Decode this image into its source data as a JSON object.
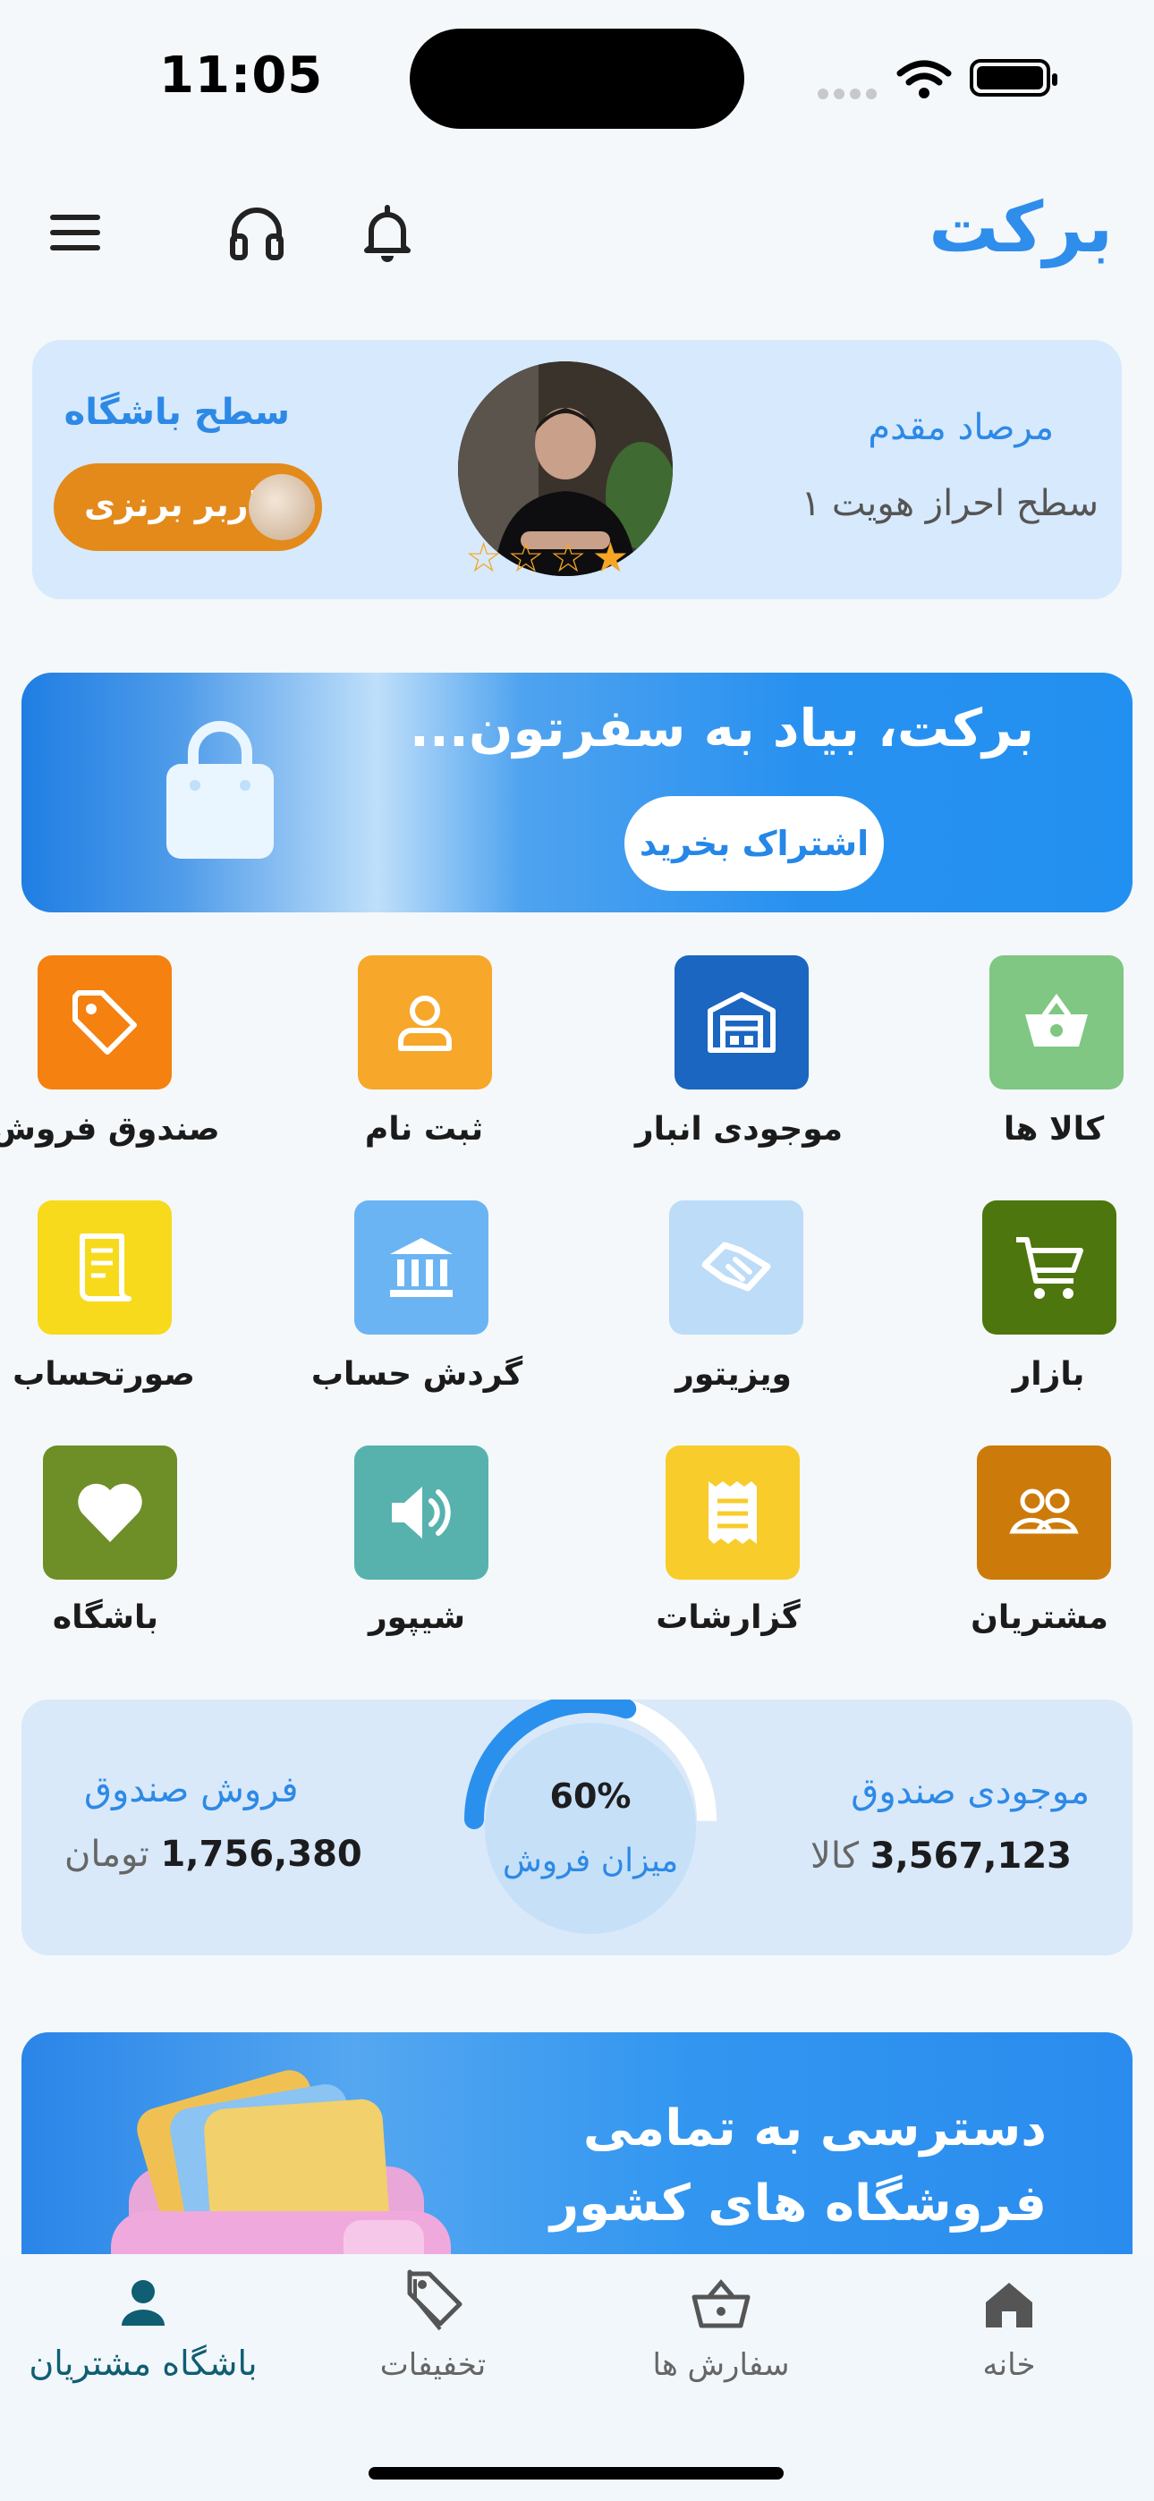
{
  "status_bar": {
    "time": "11:05"
  },
  "header": {
    "brand": "برکت"
  },
  "profile": {
    "name": "مرصاد مقدم",
    "identity_level": "سطح احراز هویت ۱",
    "club_level_title": "سطح باشگاه",
    "club_level_value": "کاربر برنزی",
    "rating": 1,
    "rating_max": 4
  },
  "banner": {
    "title": "برکت، بیاد به سفرتون...",
    "button": "اشتراک بخرید"
  },
  "grid": [
    {
      "label": "کالا ها",
      "icon": "basket-icon",
      "color": "#7FC782"
    },
    {
      "label": "موجودی انبار",
      "icon": "warehouse-icon",
      "color": "#1A66C0"
    },
    {
      "label": "ثبت نام",
      "icon": "user-icon",
      "color": "#F7A72A"
    },
    {
      "label": "صندوق فروش",
      "icon": "tag-icon",
      "color": "#F58110"
    },
    {
      "label": "بازار",
      "icon": "cart-icon",
      "color": "#4E760E"
    },
    {
      "label": "ویزیتور",
      "icon": "handshake-icon",
      "color": "#BCDCF8"
    },
    {
      "label": "گردش حساب",
      "icon": "bank-icon",
      "color": "#6BB4F3"
    },
    {
      "label": "صورتحساب",
      "icon": "receipt-icon",
      "color": "#F7DA1C"
    },
    {
      "label": "مشتریان",
      "icon": "users-icon",
      "color": "#CC7A0A"
    },
    {
      "label": "گزارشات",
      "icon": "report-icon",
      "color": "#F8CC2A"
    },
    {
      "label": "شیپور",
      "icon": "speaker-icon",
      "color": "#57B2AE"
    },
    {
      "label": "باشگاه",
      "icon": "heart-icon",
      "color": "#6E8E27"
    }
  ],
  "stats": {
    "inventory_title": "موجودی صندوق",
    "inventory_value": "3,567,123",
    "inventory_unit": "کالا",
    "sales_title": "فروش صندوق",
    "sales_value": "1,756,380",
    "sales_unit": "تومان",
    "gauge_percent_label": "60%",
    "gauge_percent": 60,
    "gauge_caption": "میزان فروش"
  },
  "promo": {
    "line1": "دسترسی به تمامی",
    "line2": "فروشگاه های کشور"
  },
  "tabbar": {
    "home": "خانه",
    "orders": "سفارش ها",
    "discounts": "تخفیفات",
    "club": "باشگاه مشتریان"
  },
  "colors": {
    "accent": "#2D89E6",
    "active_tab": "#0F5E72"
  }
}
